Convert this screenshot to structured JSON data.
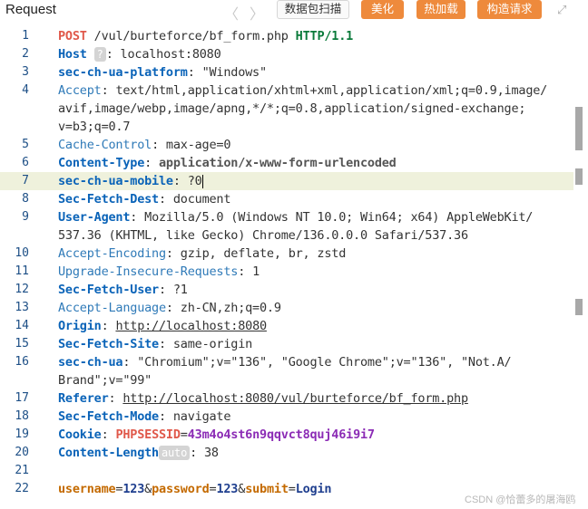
{
  "panel": {
    "title": "Request",
    "nav_back": "〈",
    "nav_forward": "〉",
    "capture_button": "数据包扫描",
    "beautify_button": "美化",
    "hot_load_button": "热加载",
    "construct_button": "构造请求",
    "expand_icon": "expand-icon"
  },
  "line_numbers": [
    "1",
    "2",
    "3",
    "4",
    "5",
    "6",
    "7",
    "8",
    "9",
    "10",
    "11",
    "12",
    "13",
    "14",
    "15",
    "16",
    "17",
    "18",
    "19",
    "20",
    "21",
    "22"
  ],
  "request": {
    "method": "POST",
    "path": "/vul/burteforce/bf_form.php",
    "protocol": "HTTP/1.1",
    "host_key": "Host",
    "host_tag": "?",
    "host_value": "localhost:8080",
    "platform_key": "sec-ch-ua-platform",
    "platform_value": "\"Windows\"",
    "accept_key": "Accept",
    "accept_value_1": "text/html,application/xhtml+xml,application/xml;q=0.9,image/",
    "accept_value_2": "avif,image/webp,image/apng,*/*;q=0.8,application/signed-exchange;",
    "accept_value_3": "v=b3;q=0.7",
    "cache_key": "Cache-Control",
    "cache_value": "max-age=0",
    "ctype_key": "Content-Type",
    "ctype_value": "application/x-www-form-urlencoded",
    "mobile_key": "sec-ch-ua-mobile",
    "mobile_value": "?0",
    "dest_key": "Sec-Fetch-Dest",
    "dest_value": "document",
    "ua_key": "User-Agent",
    "ua_value_1": "Mozilla/5.0 (Windows NT 10.0; Win64; x64) AppleWebKit/",
    "ua_value_2": "537.36 (KHTML, like Gecko) Chrome/136.0.0.0 Safari/537.36",
    "enc_key": "Accept-Encoding",
    "enc_value": "gzip, deflate, br, zstd",
    "upg_key": "Upgrade-Insecure-Requests",
    "upg_value": "1",
    "user_key": "Sec-Fetch-User",
    "user_value": "?1",
    "lang_key": "Accept-Language",
    "lang_value": "zh-CN,zh;q=0.9",
    "origin_key": "Origin",
    "origin_value": "http://localhost:8080",
    "site_key": "Sec-Fetch-Site",
    "site_value": "same-origin",
    "secua_key": "sec-ch-ua",
    "secua_value_1": "\"Chromium\";v=\"136\", \"Google Chrome\";v=\"136\", \"Not.A/",
    "secua_value_2": "Brand\";v=\"99\"",
    "referer_key": "Referer",
    "referer_value": "http://localhost:8080/vul/burteforce/bf_form.php",
    "mode_key": "Sec-Fetch-Mode",
    "mode_value": "navigate",
    "cookie_key": "Cookie",
    "cookie_name": "PHPSESSID",
    "cookie_value": "43m4o4st6n9qqvct8quj46i9i7",
    "clen_key": "Content-Length",
    "clen_tag": "auto",
    "clen_value": "38",
    "body_k1": "username",
    "body_v1": "123",
    "body_k2": "password",
    "body_v2": "123",
    "body_k3": "submit",
    "body_v3": "Login"
  },
  "watermark": "CSDN @恰蕾多的屠海鸥"
}
